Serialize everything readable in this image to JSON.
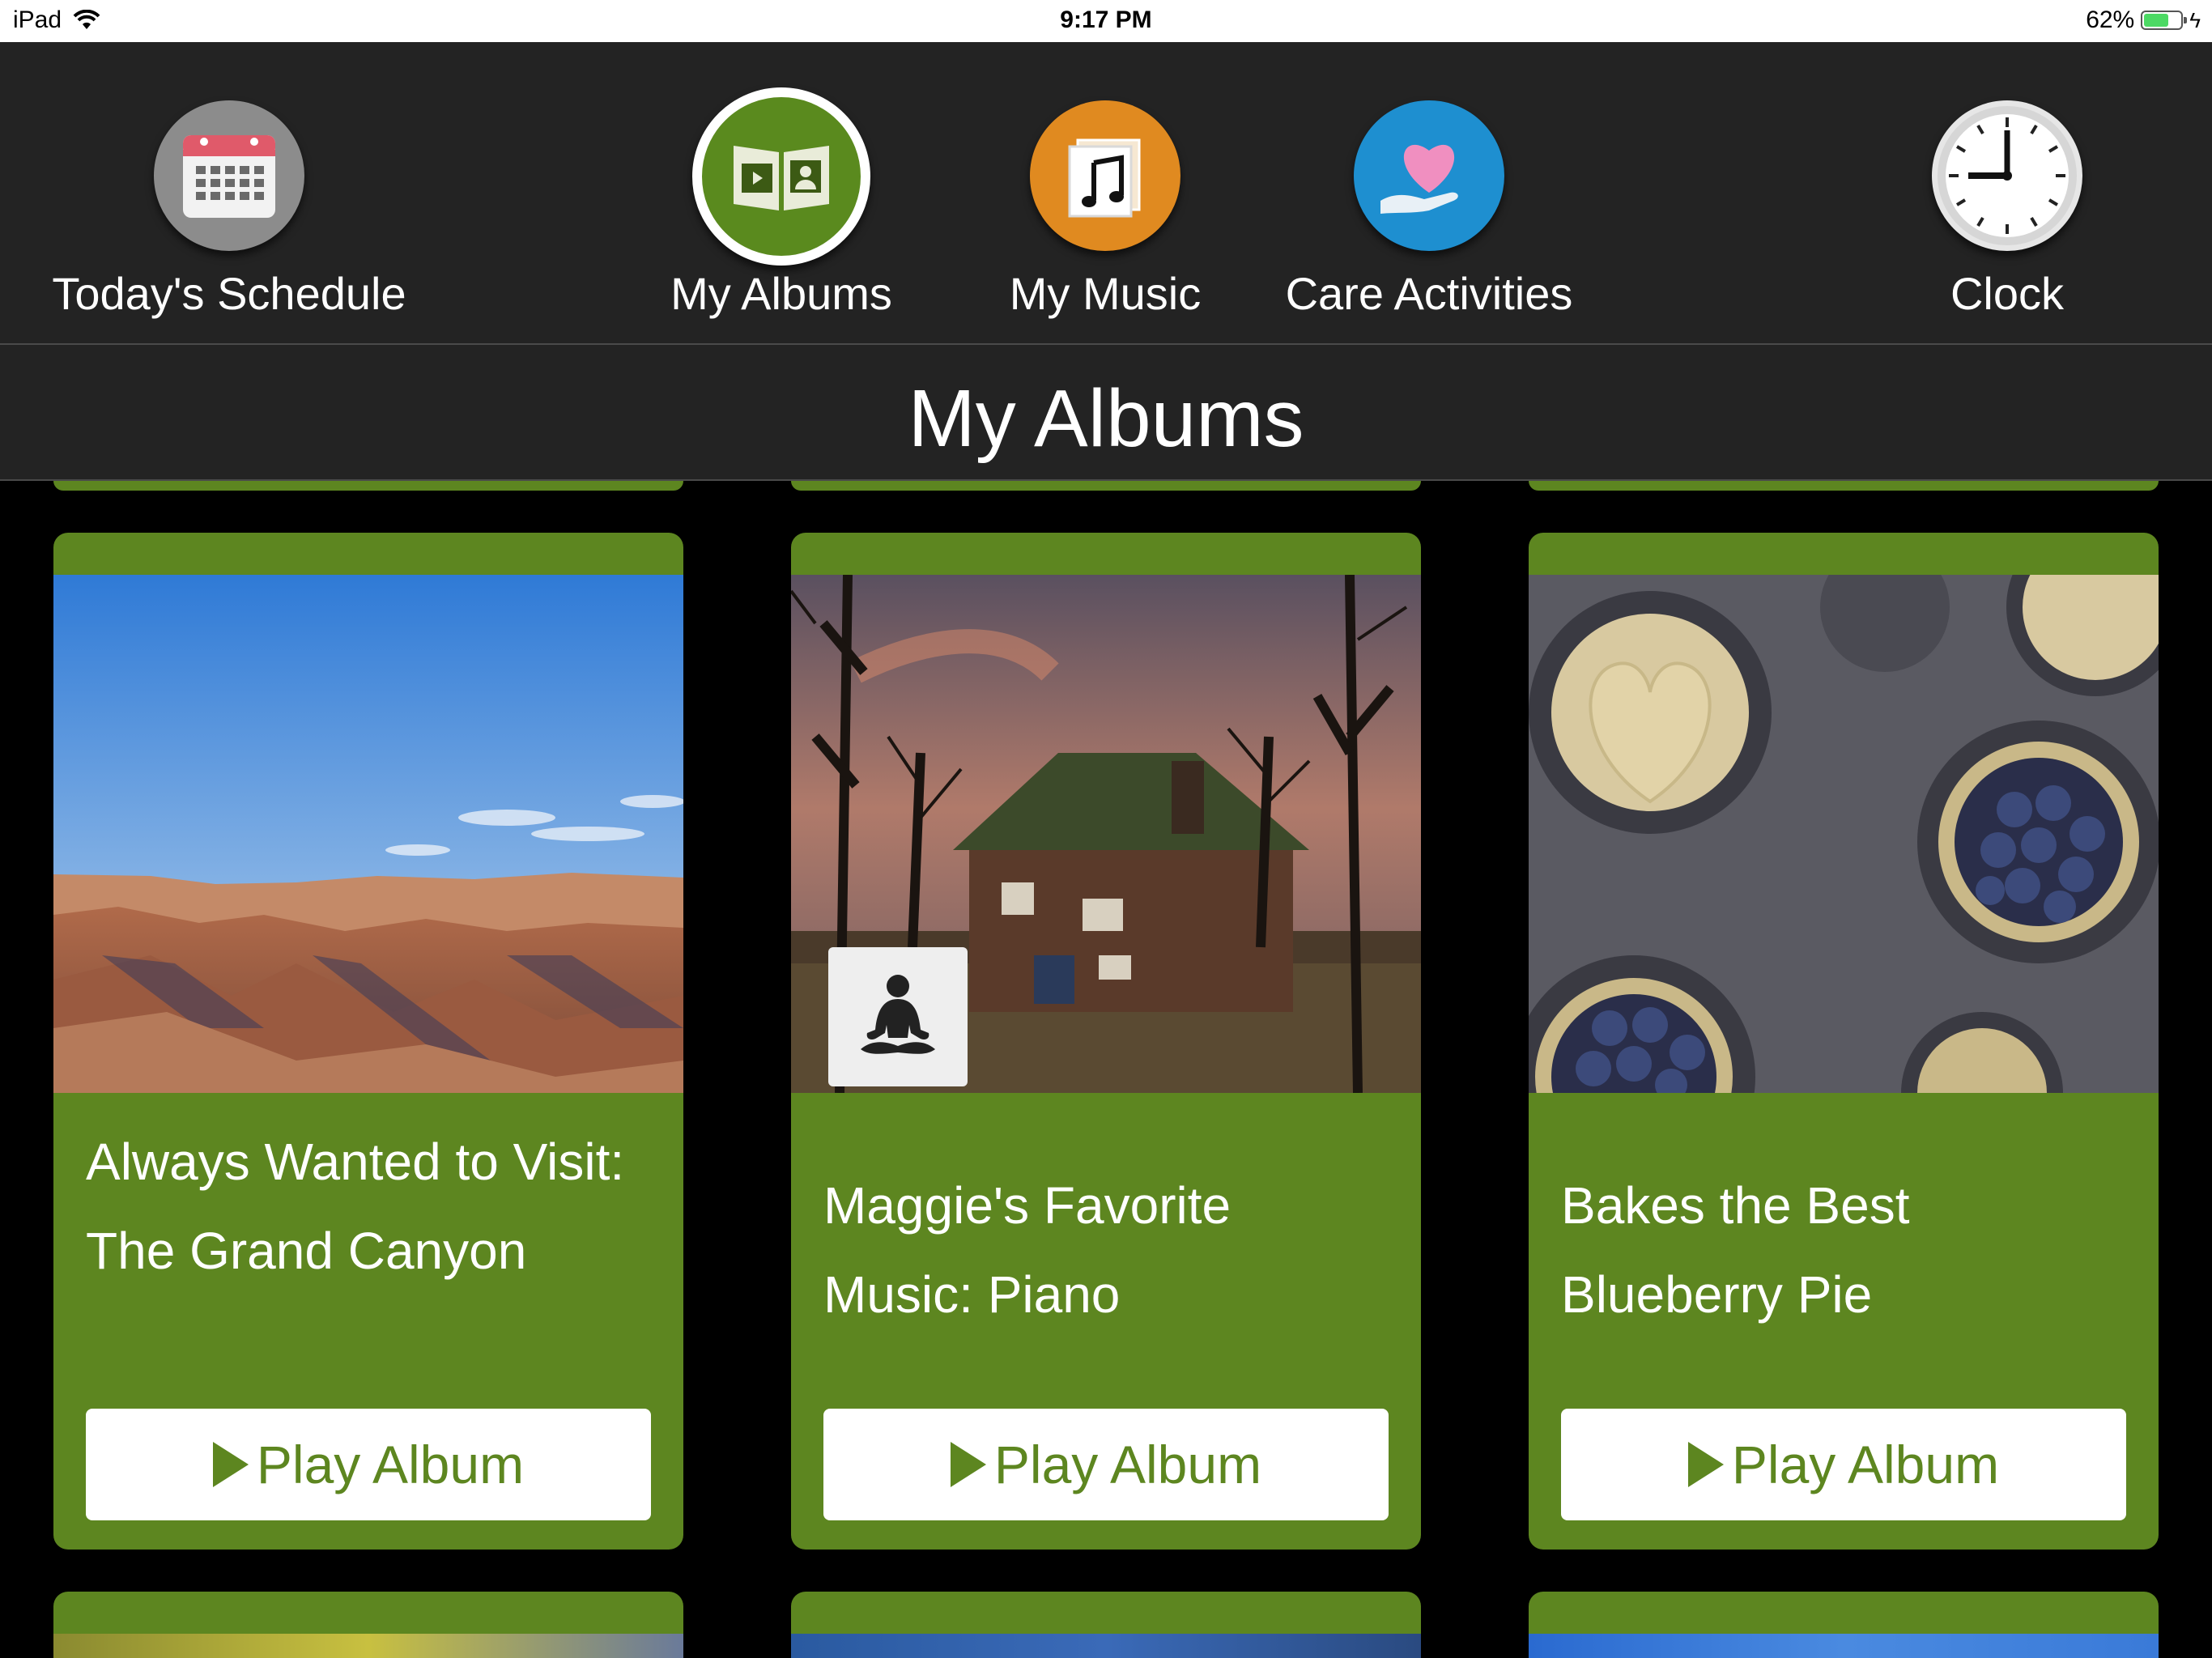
{
  "status_bar": {
    "device": "iPad",
    "time": "9:17 PM",
    "battery": "62%",
    "battery_level": 0.62
  },
  "nav": {
    "items": [
      {
        "label": "Today's Schedule",
        "icon": "calendar-icon",
        "color": "#8c8c8c",
        "active": false
      },
      {
        "label": "My Albums",
        "icon": "photo-album-icon",
        "color": "#5a8a1e",
        "active": true
      },
      {
        "label": "My Music",
        "icon": "music-note-icon",
        "color": "#e08a20",
        "active": false
      },
      {
        "label": "Care Activities",
        "icon": "heart-hand-icon",
        "color": "#1e8fd0",
        "active": false
      },
      {
        "label": "Clock",
        "icon": "clock-icon",
        "color": "#e6e6e6",
        "active": false
      }
    ]
  },
  "page": {
    "title": "My Albums"
  },
  "albums": [
    {
      "title": "Always Wanted to Visit: The Grand Canyon",
      "button": "Play Album",
      "image": "grand-canyon"
    },
    {
      "title": "Maggie's Favorite Music: Piano",
      "button": "Play Album",
      "image": "house-trees",
      "badge": "meditation-icon"
    },
    {
      "title": "Bakes the Best Blueberry Pie",
      "button": "Play Album",
      "image": "blueberry-pie"
    }
  ],
  "theme": {
    "card_green": "#5d8620",
    "header_bg": "#232323",
    "background": "#000000"
  }
}
